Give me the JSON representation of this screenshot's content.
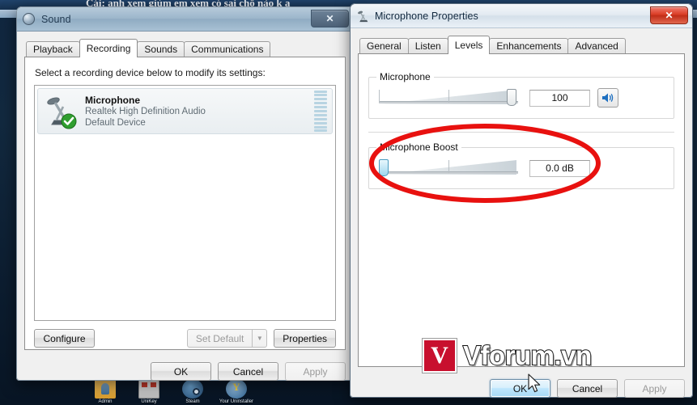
{
  "desktop": {
    "background_text": "Cái: anh xem giùm em xem có sai chỗ nào k ạ",
    "icons": [
      {
        "label": "Admin",
        "icon": "user-folder-icon"
      },
      {
        "label": "UniKey",
        "icon": "unikey-icon"
      },
      {
        "label": "Steam",
        "icon": "steam-icon"
      },
      {
        "label": "Your Uninstaller",
        "icon": "yahoo-icon"
      }
    ]
  },
  "sound_window": {
    "title": "Sound",
    "title_icon": "speaker-icon",
    "close_label": "✕",
    "tabs": [
      {
        "label": "Playback",
        "active": false
      },
      {
        "label": "Recording",
        "active": true
      },
      {
        "label": "Sounds",
        "active": false
      },
      {
        "label": "Communications",
        "active": false
      }
    ],
    "hint": "Select a recording device below to modify its settings:",
    "devices": [
      {
        "name": "Microphone",
        "driver": "Realtek High Definition Audio",
        "status": "Default Device",
        "icon": "microphone-icon",
        "badge": "default-check-icon",
        "meter_segments": 11
      }
    ],
    "buttons": {
      "configure": "Configure",
      "set_default": "Set Default",
      "set_default_arrow": "▼",
      "properties": "Properties"
    },
    "footer": {
      "ok": "OK",
      "cancel": "Cancel",
      "apply": "Apply"
    }
  },
  "properties_window": {
    "title": "Microphone Properties",
    "title_icon": "microphone-icon",
    "close_label": "✕",
    "tabs": [
      {
        "label": "General",
        "active": false
      },
      {
        "label": "Listen",
        "active": false
      },
      {
        "label": "Levels",
        "active": true
      },
      {
        "label": "Enhancements",
        "active": false
      },
      {
        "label": "Advanced",
        "active": false
      }
    ],
    "levels": {
      "microphone": {
        "legend": "Microphone",
        "value": "100",
        "slider_percent": 100,
        "mute_button_icon": "speaker-on-icon"
      },
      "microphone_boost": {
        "legend": "Microphone Boost",
        "value": "0.0 dB",
        "slider_percent": 0
      }
    },
    "footer": {
      "ok": "OK",
      "cancel": "Cancel",
      "apply": "Apply"
    }
  },
  "watermark": {
    "mark_letter": "V",
    "text": "Vforum.vn",
    "color": "#c8102e"
  },
  "annotation": {
    "shape": "ellipse",
    "color": "#e8110f",
    "target": "Microphone Boost"
  },
  "cursor": {
    "icon": "arrow-cursor"
  }
}
